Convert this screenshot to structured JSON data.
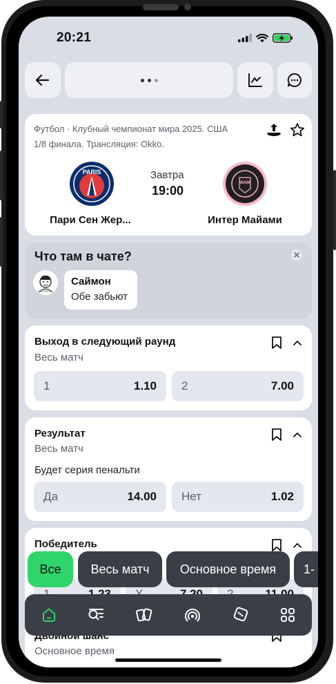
{
  "status": {
    "time": "20:21"
  },
  "topbar": {
    "back_icon": "arrow-left-icon",
    "menu_icon": "more-dots-icon",
    "stats_icon": "chart-icon",
    "chat_icon": "chat-bubble-icon"
  },
  "match": {
    "info_line1": "Футбол · Клубный чемпионат мира 2025. США",
    "info_line2": "1/8 финала. Трансляция: Okko.",
    "share_icon": "share-icon",
    "favorite_icon": "star-icon",
    "home_team": "Пари Сен Жер...",
    "away_team": "Интер Майами",
    "day": "Завтра",
    "time": "19:00",
    "home_logo_text": "PARIS",
    "away_logo_text": "MIAMI",
    "home_color": "#0b2d6b",
    "home_accent": "#e23b3b",
    "away_color": "#231f20",
    "away_accent": "#f5b6cd"
  },
  "chat": {
    "title": "Что там в чате?",
    "close_icon": "close-icon",
    "user_name": "Саймон",
    "message": "Обе забьют"
  },
  "markets": [
    {
      "title": "Выход в следующий раунд",
      "subtitle": "Весь матч",
      "odds": [
        {
          "label": "1",
          "value": "1.10"
        },
        {
          "label": "2",
          "value": "7.00"
        }
      ]
    },
    {
      "title": "Результат",
      "subtitle": "Весь матч",
      "question": "Будет серия пенальти",
      "odds": [
        {
          "label": "Да",
          "value": "14.00"
        },
        {
          "label": "Нет",
          "value": "1.02"
        }
      ]
    },
    {
      "title": "Победитель",
      "subtitle": "",
      "odds": [
        {
          "label": "1",
          "value": "1.23"
        },
        {
          "label": "X",
          "value": "7.20"
        },
        {
          "label": "2",
          "value": "11.00"
        }
      ]
    },
    {
      "title": "Двойной шанс",
      "subtitle": "Основное время"
    }
  ],
  "filters": {
    "chips": [
      "Все",
      "Весь матч",
      "Основное время",
      "1-"
    ],
    "active": 0
  },
  "tabbar": {
    "items": [
      "home-icon",
      "search-list-icon",
      "cards-icon",
      "live-broadcast-icon",
      "dice-icon",
      "grid-menu-icon"
    ]
  },
  "colors": {
    "accent_green": "#2fd46a",
    "screen_bg": "#d9dde5",
    "dark_bar": "#3a3e46"
  }
}
